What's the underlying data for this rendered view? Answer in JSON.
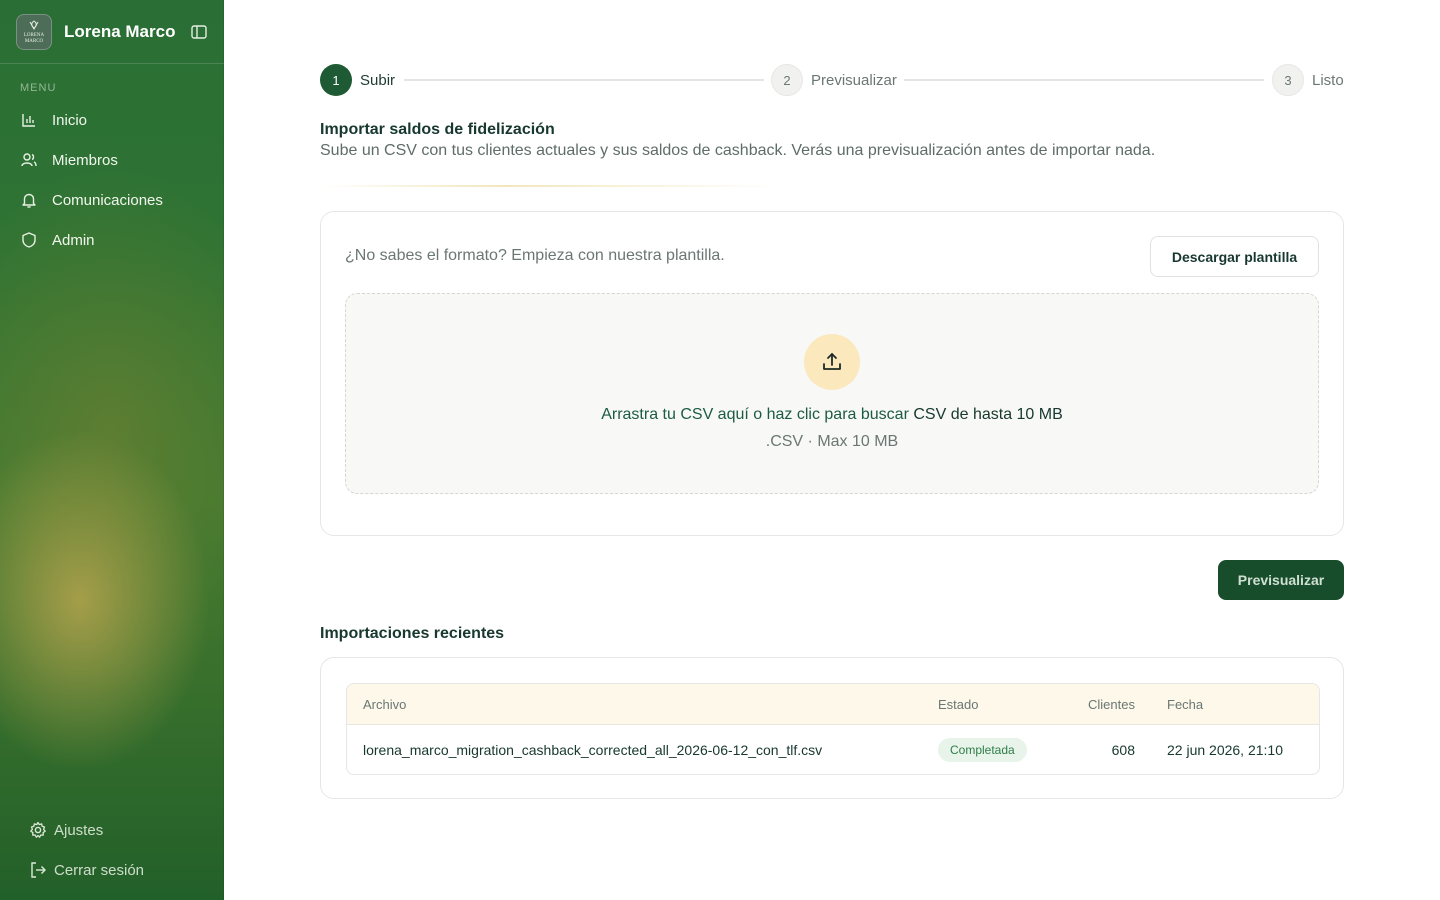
{
  "brand": {
    "name": "Lorena Marco",
    "logo_text": "LORENA MARCO"
  },
  "sidebar": {
    "menu_label": "MENU",
    "items": [
      {
        "label": "Inicio",
        "icon": "bar-chart-icon"
      },
      {
        "label": "Miembros",
        "icon": "users-icon"
      },
      {
        "label": "Comunicaciones",
        "icon": "bell-icon"
      },
      {
        "label": "Admin",
        "icon": "shield-icon"
      }
    ],
    "bottom": [
      {
        "label": "Ajustes",
        "icon": "gear-icon"
      },
      {
        "label": "Cerrar sesión",
        "icon": "logout-icon"
      }
    ]
  },
  "stepper": {
    "steps": [
      {
        "number": "1",
        "label": "Subir",
        "state": "active"
      },
      {
        "number": "2",
        "label": "Previsualizar",
        "state": "inactive"
      },
      {
        "number": "3",
        "label": "Listo",
        "state": "inactive"
      }
    ]
  },
  "page": {
    "title": "Importar saldos de fidelización",
    "subtitle": "Sube un CSV con tus clientes actuales y sus saldos de cashback. Verás una previsualización antes de importar nada."
  },
  "upload": {
    "template_hint": "¿No sabes el formato? Empieza con nuestra plantilla.",
    "download_button": "Descargar plantilla",
    "drop_link": "Arrastra tu CSV aquí o haz clic para buscar",
    "drop_strong": "CSV de hasta 10 MB",
    "drop_sub": ".CSV · Max 10 MB"
  },
  "preview_button": "Previsualizar",
  "recent": {
    "title": "Importaciones recientes",
    "columns": [
      "Archivo",
      "Estado",
      "Clientes",
      "Fecha"
    ],
    "rows": [
      {
        "file": "lorena_marco_migration_cashback_corrected_all_2026-06-12_con_tlf.csv",
        "status": "Completada",
        "clients": "608",
        "date": "22 jun 2026, 21:10"
      }
    ]
  },
  "colors": {
    "primary": "#184d2c",
    "step_active": "#1e5a33",
    "badge_bg": "#e8f3ea",
    "badge_text": "#2f7d4a",
    "upload_circle": "#fbe8bd",
    "table_header_bg": "#fdf8ea"
  }
}
